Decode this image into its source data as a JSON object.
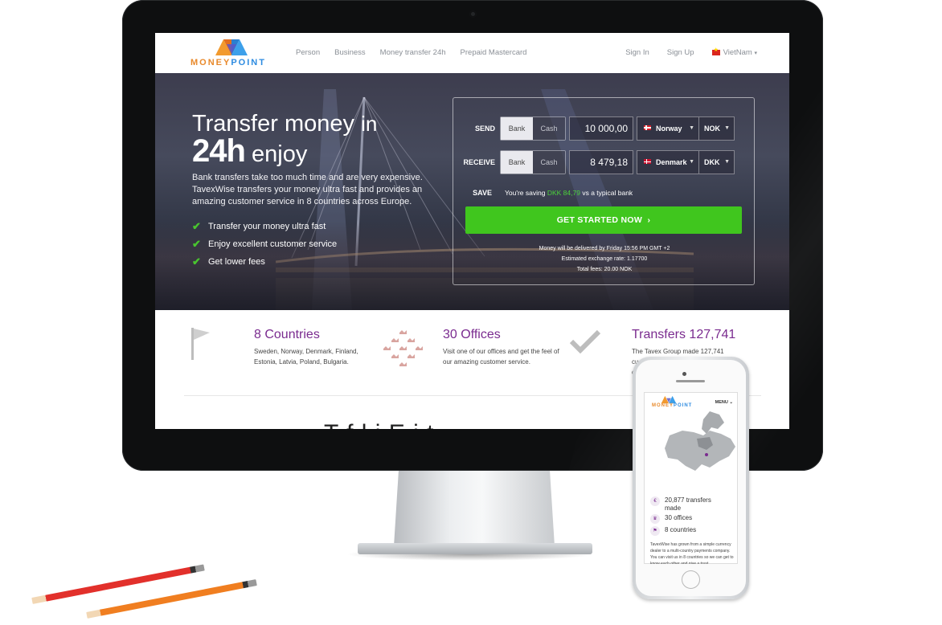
{
  "site": {
    "logo_text_a": "MONEY",
    "logo_text_b": "POINT",
    "nav": [
      "Person",
      "Business",
      "Money transfer 24h",
      "Prepaid Mastercard"
    ],
    "sign_in": "Sign In",
    "sign_up": "Sign Up",
    "language": "VietNam"
  },
  "hero": {
    "title_line1_a": "Transfer money",
    "title_line1_b": "in",
    "title_big": "24h",
    "title_line2_b": "enjoy",
    "subtitle": "Bank transfers take too much time and are very expensive. TavexWise transfers your money ultra fast and provides an amazing customer service in 8 countries across Europe.",
    "checks": [
      "Transfer your money ultra fast",
      "Enjoy excellent customer service",
      "Get lower fees"
    ]
  },
  "calculator": {
    "send_label": "SEND",
    "receive_label": "RECEIVE",
    "save_label": "SAVE",
    "bank": "Bank",
    "cash": "Cash",
    "send_amount": "10 000,00",
    "receive_amount": "8 479,18",
    "send_country": "Norway",
    "receive_country": "Denmark",
    "send_currency": "NOK",
    "receive_currency": "DKK",
    "save_prefix": "You're saving",
    "save_amount": "DKK 84,79",
    "save_suffix": "vs a typical bank",
    "cta": "GET STARTED NOW",
    "delivery": "Money will be delivered by Friday 15:56 PM GMT +2",
    "rate": "Estimated exchange rate: 1.17700",
    "fees": "Total fees: 20.00 NOK"
  },
  "features": {
    "countries_title": "8 Countries",
    "countries_text": "Sweden, Norway, Denmark, Finland, Estonia, Latvia, Poland, Bulgaria.",
    "offices_title": "30 Offices",
    "offices_text": "Visit one of our offices and get the feel of our amazing customer service.",
    "transfers_title": "Transfers 127,741",
    "transfers_text_1": "The Tavex Group made 127,741",
    "transfers_text_2": "cu",
    "transfers_text_3": "co",
    "heading_partial": "T  f  l i E  i  t"
  },
  "phone": {
    "logo_a": "MONEY",
    "logo_b": "POINT",
    "menu": "MENU",
    "stats": [
      "20,877 transfers made",
      "30 offices",
      "8 countries"
    ],
    "paragraph": "TavexWise has grown from a simple currency dealer to a multi-country payments company. You can visit us in 8 countries so we can get to know each other and give a trust"
  },
  "colors": {
    "accent_purple": "#7a2b8f",
    "cta_green": "#40c61e",
    "logo_orange": "#e8892b",
    "logo_blue": "#2d8be0"
  }
}
